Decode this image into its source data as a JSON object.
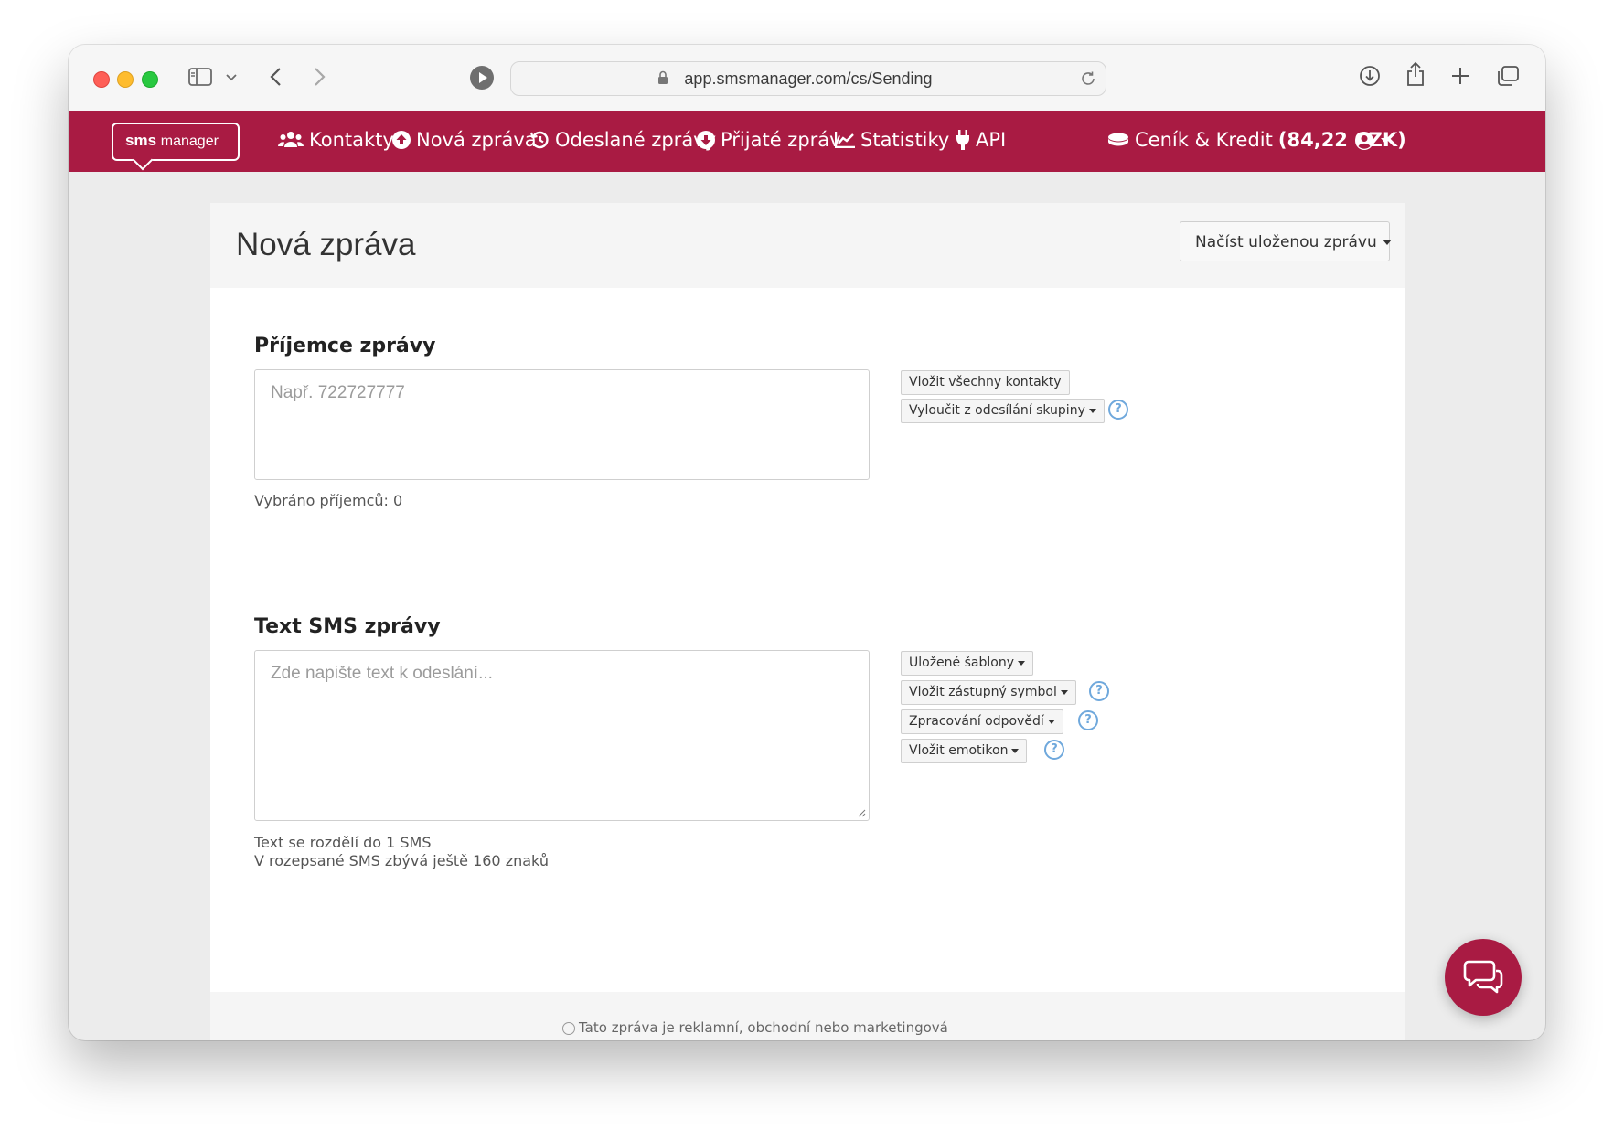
{
  "browser": {
    "url": "app.smsmanager.com/cs/Sending"
  },
  "navbar": {
    "logo_sms": "sms",
    "logo_manager": "manager",
    "items": [
      {
        "label": "Kontakty",
        "icon": "users-icon"
      },
      {
        "label": "Nová zpráva",
        "icon": "upload-circle-icon"
      },
      {
        "label": "Odeslané zprávy",
        "icon": "history-icon"
      },
      {
        "label": "Přijaté zpráv",
        "icon": "download-circle-icon"
      },
      {
        "label": "Statistiky",
        "icon": "chart-line-icon"
      },
      {
        "label": "API",
        "icon": "plug-icon"
      }
    ],
    "credit_label": "Ceník & Kredit",
    "credit_value": "(84,22 CZK)",
    "brand_color": "#a91b43"
  },
  "page": {
    "title": "Nová zpráva",
    "load_saved_label": "Načíst uloženou zprávu"
  },
  "recipients": {
    "title": "Příjemce zprávy",
    "placeholder": "Např. 722727777",
    "count_text": "Vybráno příjemců: 0",
    "insert_all_label": "Vložit všechny kontakty",
    "exclude_group_label": "Vyloučit z odesílání skupiny"
  },
  "message": {
    "title": "Text SMS zprávy",
    "placeholder": "Zde napište text k odeslání...",
    "split_text": "Text se rozdělí do 1 SMS",
    "remaining_text": "V rozepsané SMS zbývá ještě 160 znaků",
    "saved_templates_label": "Uložené šablony",
    "insert_placeholder_label": "Vložit zástupný symbol",
    "reply_processing_label": "Zpracování odpovědí",
    "insert_emoticon_label": "Vložit emotikon"
  },
  "footer": {
    "marketing_label": "Tato zpráva je reklamní, obchodní nebo marketingová"
  },
  "help_symbol": "?"
}
